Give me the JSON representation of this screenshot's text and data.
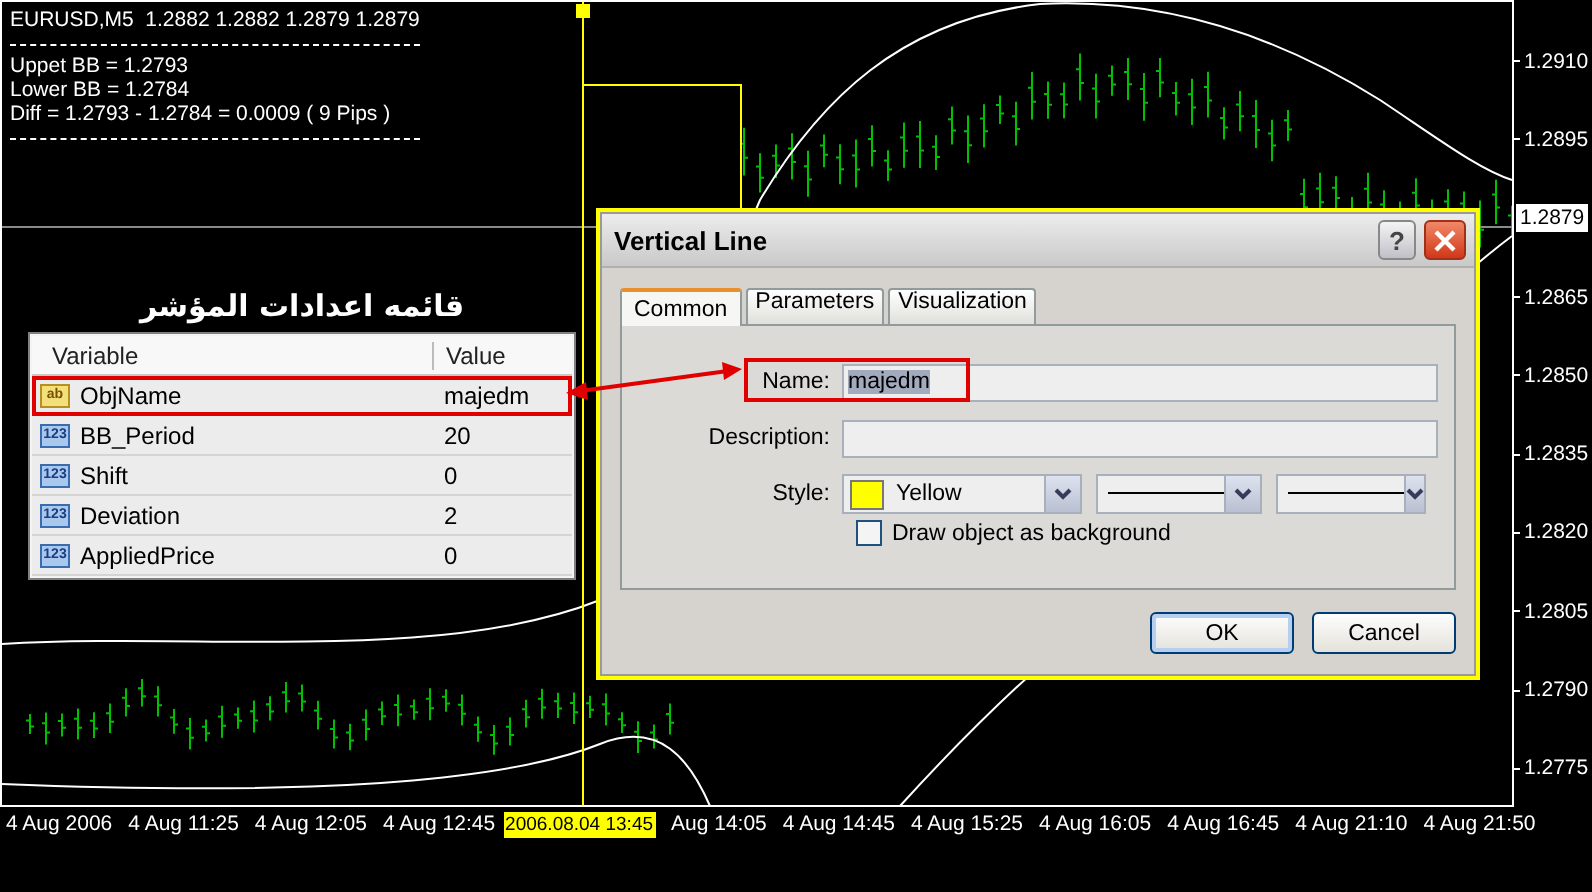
{
  "chart": {
    "header": "EURUSD,M5  1.2882 1.2882 1.2879 1.2879",
    "info_lines": [
      "Uppet BB = 1.2793",
      "Lower BB = 1.2784",
      "Diff = 1.2793 - 1.2784 = 0.0009 ( 9 Pips )"
    ]
  },
  "price_axis": [
    {
      "label": "1.2910",
      "kind": "tick"
    },
    {
      "label": "1.2895",
      "kind": "tick"
    },
    {
      "label": "1.2879",
      "kind": "current"
    },
    {
      "label": "1.2865",
      "kind": "tick"
    },
    {
      "label": "1.2850",
      "kind": "tick"
    },
    {
      "label": "1.2835",
      "kind": "tick"
    },
    {
      "label": "1.2820",
      "kind": "tick"
    },
    {
      "label": "1.2805",
      "kind": "tick"
    },
    {
      "label": "1.2790",
      "kind": "tick"
    },
    {
      "label": "1.2775",
      "kind": "tick"
    }
  ],
  "time_axis": [
    {
      "label": "4 Aug 2006",
      "kind": "tick"
    },
    {
      "label": "4 Aug 11:25",
      "kind": "tick"
    },
    {
      "label": "4 Aug 12:05",
      "kind": "tick"
    },
    {
      "label": "4 Aug 12:45",
      "kind": "tick"
    },
    {
      "label": "2006.08.04 13:45",
      "kind": "cursor"
    },
    {
      "label": "Aug 14:05",
      "kind": "tick"
    },
    {
      "label": "4 Aug 14:45",
      "kind": "tick"
    },
    {
      "label": "4 Aug 15:25",
      "kind": "tick"
    },
    {
      "label": "4 Aug 16:05",
      "kind": "tick"
    },
    {
      "label": "4 Aug 16:45",
      "kind": "tick"
    },
    {
      "label": "4 Aug 21:10",
      "kind": "tick"
    },
    {
      "label": "4 Aug 21:50",
      "kind": "tick"
    }
  ],
  "inputs_panel": {
    "title": "قائمه اعدادات المؤشر",
    "columns": [
      "Variable",
      "Value"
    ],
    "rows": [
      {
        "kind": "string",
        "badge": "ab",
        "variable": "ObjName",
        "value": "majedm",
        "highlighted": true
      },
      {
        "kind": "number",
        "badge": "123",
        "variable": "BB_Period",
        "value": "20",
        "highlighted": false
      },
      {
        "kind": "number",
        "badge": "123",
        "variable": "Shift",
        "value": "0",
        "highlighted": false
      },
      {
        "kind": "number",
        "badge": "123",
        "variable": "Deviation",
        "value": "2",
        "highlighted": false
      },
      {
        "kind": "number",
        "badge": "123",
        "variable": "AppliedPrice",
        "value": "0",
        "highlighted": false
      }
    ]
  },
  "dialog": {
    "title": "Vertical Line",
    "help": "?",
    "tabs": [
      {
        "label": "Common",
        "selected": true
      },
      {
        "label": "Parameters",
        "selected": false
      },
      {
        "label": "Visualization",
        "selected": false
      }
    ],
    "name": {
      "label": "Name:",
      "value": "majedm",
      "text_selected": true,
      "highlighted": true
    },
    "description": {
      "label": "Description:"
    },
    "style": {
      "label": "Style:",
      "color": "#ffff00",
      "color_name": "Yellow"
    },
    "background_checkbox": {
      "label": "Draw object as background",
      "checked": false
    },
    "buttons": [
      {
        "label": "OK",
        "default": true
      },
      {
        "label": "Cancel",
        "default": false
      }
    ]
  }
}
